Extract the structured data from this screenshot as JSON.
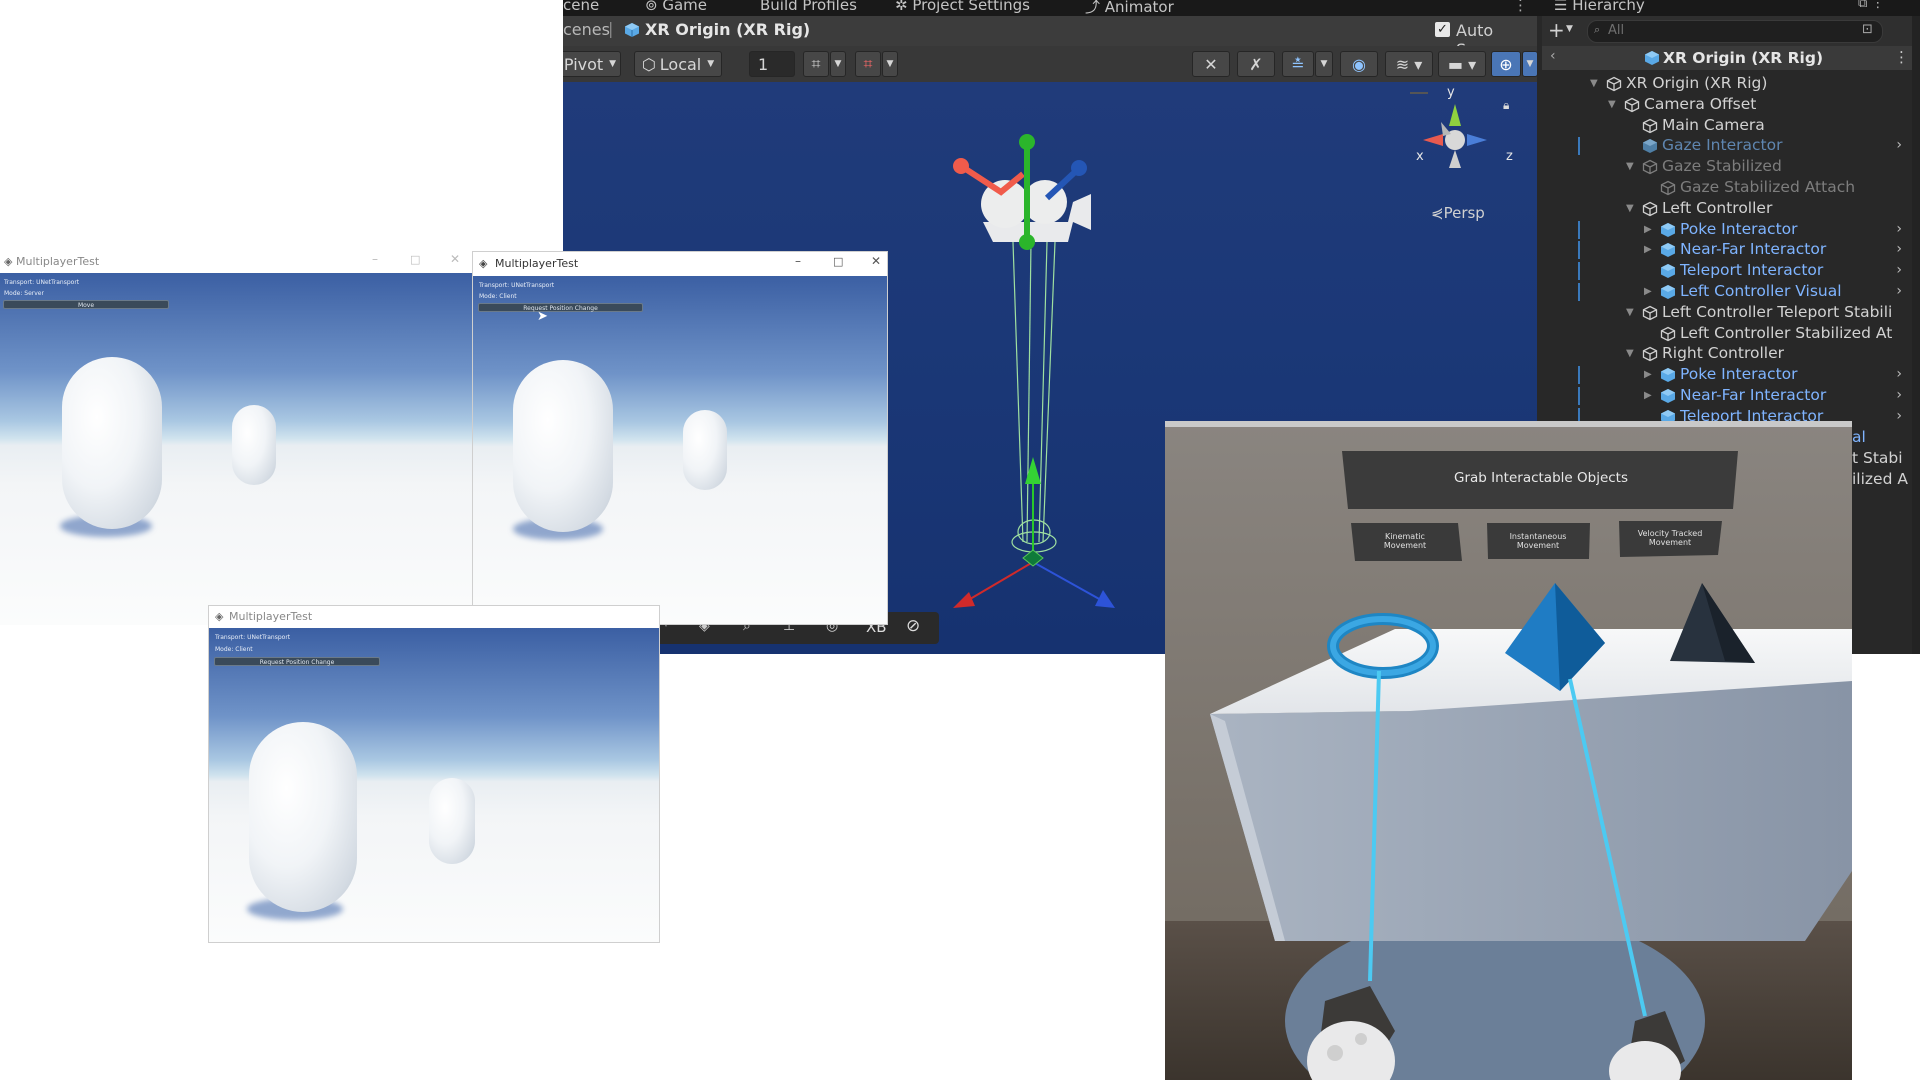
{
  "editor": {
    "top_tabs": [
      {
        "label": "cene",
        "icon": "scene-icon"
      },
      {
        "label": "Game",
        "icon": "game-icon"
      },
      {
        "label": "Build Profiles",
        "icon": ""
      },
      {
        "label": "Project Settings",
        "icon": "gear-icon"
      },
      {
        "label": "Animator",
        "icon": "animator-icon"
      }
    ],
    "breadcrumb": {
      "scenes": "cenes",
      "separator": "|",
      "current": "XR Origin (XR Rig)"
    },
    "auto_save": {
      "label": "Auto Save",
      "checked": true
    },
    "toolbar": {
      "pivot": "Pivot",
      "local": "Local",
      "grid_value": "1"
    },
    "scene_view": {
      "projection": "Persp",
      "axis_x": "x",
      "axis_y": "y",
      "axis_z": "z",
      "overlay_xb": "XB"
    }
  },
  "hierarchy": {
    "title": "Hierarchy",
    "search_placeholder": "All",
    "header": "XR Origin (XR Rig)",
    "rows": [
      {
        "label": "XR Origin (XR Rig)",
        "depth": 0,
        "expanded": true,
        "style": "normal",
        "chevron": false
      },
      {
        "label": "Camera Offset",
        "depth": 1,
        "expanded": true,
        "style": "normal",
        "chevron": false
      },
      {
        "label": "Main Camera",
        "depth": 2,
        "expanded": null,
        "style": "normal",
        "chevron": false
      },
      {
        "label": "Gaze Interactor",
        "depth": 2,
        "expanded": null,
        "style": "dim-blue",
        "chevron": true
      },
      {
        "label": "Gaze Stabilized",
        "depth": 2,
        "expanded": true,
        "style": "dim",
        "chevron": false
      },
      {
        "label": "Gaze Stabilized Attach",
        "depth": 3,
        "expanded": null,
        "style": "dim",
        "chevron": false
      },
      {
        "label": "Left Controller",
        "depth": 2,
        "expanded": true,
        "style": "normal",
        "chevron": false
      },
      {
        "label": "Poke Interactor",
        "depth": 3,
        "expanded": false,
        "style": "blue",
        "chevron": true
      },
      {
        "label": "Near-Far Interactor",
        "depth": 3,
        "expanded": false,
        "style": "blue",
        "chevron": true
      },
      {
        "label": "Teleport Interactor",
        "depth": 3,
        "expanded": null,
        "style": "blue",
        "chevron": true
      },
      {
        "label": "Left Controller Visual",
        "depth": 3,
        "expanded": false,
        "style": "blue",
        "chevron": true
      },
      {
        "label": "Left Controller Teleport Stabili",
        "depth": 2,
        "expanded": true,
        "style": "normal",
        "chevron": false
      },
      {
        "label": "Left Controller Stabilized At",
        "depth": 3,
        "expanded": null,
        "style": "normal",
        "chevron": false
      },
      {
        "label": "Right Controller",
        "depth": 2,
        "expanded": true,
        "style": "normal",
        "chevron": false
      },
      {
        "label": "Poke Interactor",
        "depth": 3,
        "expanded": false,
        "style": "blue",
        "chevron": true
      },
      {
        "label": "Near-Far Interactor",
        "depth": 3,
        "expanded": false,
        "style": "blue",
        "chevron": true
      },
      {
        "label": "Teleport Interactor",
        "depth": 3,
        "expanded": null,
        "style": "blue",
        "chevron": true
      }
    ],
    "peek_fragments": [
      "al",
      "t Stabi",
      "ilized A"
    ]
  },
  "game_windows": [
    {
      "title": "MultiplayerTest",
      "transport": "Transport: UNetTransport",
      "mode": "Mode: Server",
      "button": "Move"
    },
    {
      "title": "MultiplayerTest",
      "transport": "Transport: UNetTransport",
      "mode": "Mode: Client",
      "button": "Request Position Change"
    },
    {
      "title": "MultiplayerTest",
      "transport": "Transport: UNetTransport",
      "mode": "Mode: Client",
      "button": "Request Position Change"
    }
  ],
  "vr": {
    "board_title": "Grab Interactable Objects",
    "buttons": [
      "Kinematic Movement",
      "Instantaneous Movement",
      "Velocity Tracked Movement"
    ]
  },
  "colors": {
    "selection_blue": "#3a79bb",
    "prefab_blue": "#7fb4ff",
    "scene_bg": "#1b3877",
    "ray_cyan": "#4ccaf2"
  }
}
